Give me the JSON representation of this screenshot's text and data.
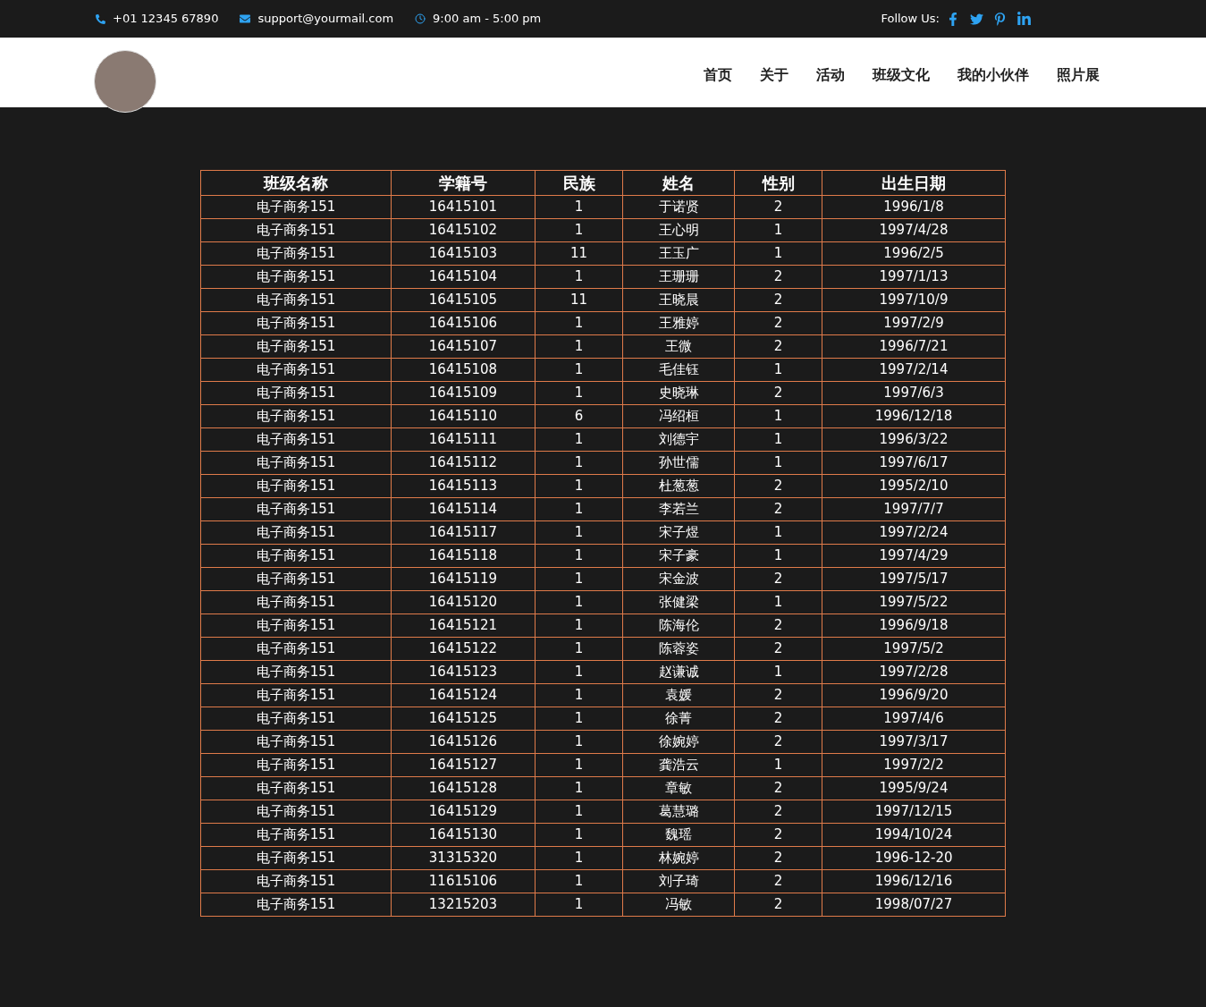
{
  "topbar": {
    "phone": "+01 12345 67890",
    "email": "support@yourmail.com",
    "hours": "9:00 am - 5:00 pm",
    "follow_label": "Follow Us:"
  },
  "nav": {
    "items": [
      {
        "label": "首页"
      },
      {
        "label": "关于"
      },
      {
        "label": "活动"
      },
      {
        "label": "班级文化"
      },
      {
        "label": "我的小伙伴"
      },
      {
        "label": "照片展"
      }
    ]
  },
  "table": {
    "columns": [
      "班级名称",
      "学籍号",
      "民族",
      "姓名",
      "性别",
      "出生日期"
    ],
    "rows": [
      [
        "电子商务151",
        "16415101",
        "1",
        "于诺贤",
        "2",
        "1996/1/8"
      ],
      [
        "电子商务151",
        "16415102",
        "1",
        "王心明",
        "1",
        "1997/4/28"
      ],
      [
        "电子商务151",
        "16415103",
        "11",
        "王玉广",
        "1",
        "1996/2/5"
      ],
      [
        "电子商务151",
        "16415104",
        "1",
        "王珊珊",
        "2",
        "1997/1/13"
      ],
      [
        "电子商务151",
        "16415105",
        "11",
        "王晓晨",
        "2",
        "1997/10/9"
      ],
      [
        "电子商务151",
        "16415106",
        "1",
        "王雅婷",
        "2",
        "1997/2/9"
      ],
      [
        "电子商务151",
        "16415107",
        "1",
        "王微",
        "2",
        "1996/7/21"
      ],
      [
        "电子商务151",
        "16415108",
        "1",
        "毛佳钰",
        "1",
        "1997/2/14"
      ],
      [
        "电子商务151",
        "16415109",
        "1",
        "史晓琳",
        "2",
        "1997/6/3"
      ],
      [
        "电子商务151",
        "16415110",
        "6",
        "冯绍桓",
        "1",
        "1996/12/18"
      ],
      [
        "电子商务151",
        "16415111",
        "1",
        "刘德宇",
        "1",
        "1996/3/22"
      ],
      [
        "电子商务151",
        "16415112",
        "1",
        "孙世儒",
        "1",
        "1997/6/17"
      ],
      [
        "电子商务151",
        "16415113",
        "1",
        "杜葱葱",
        "2",
        "1995/2/10"
      ],
      [
        "电子商务151",
        "16415114",
        "1",
        "李若兰",
        "2",
        "1997/7/7"
      ],
      [
        "电子商务151",
        "16415117",
        "1",
        "宋子煜",
        "1",
        "1997/2/24"
      ],
      [
        "电子商务151",
        "16415118",
        "1",
        "宋子豪",
        "1",
        "1997/4/29"
      ],
      [
        "电子商务151",
        "16415119",
        "1",
        "宋金波",
        "2",
        "1997/5/17"
      ],
      [
        "电子商务151",
        "16415120",
        "1",
        "张健梁",
        "1",
        "1997/5/22"
      ],
      [
        "电子商务151",
        "16415121",
        "1",
        "陈海伦",
        "2",
        "1996/9/18"
      ],
      [
        "电子商务151",
        "16415122",
        "1",
        "陈蓉姿",
        "2",
        "1997/5/2"
      ],
      [
        "电子商务151",
        "16415123",
        "1",
        "赵谦诚",
        "1",
        "1997/2/28"
      ],
      [
        "电子商务151",
        "16415124",
        "1",
        "袁媛",
        "2",
        "1996/9/20"
      ],
      [
        "电子商务151",
        "16415125",
        "1",
        "徐菁",
        "2",
        "1997/4/6"
      ],
      [
        "电子商务151",
        "16415126",
        "1",
        "徐婉婷",
        "2",
        "1997/3/17"
      ],
      [
        "电子商务151",
        "16415127",
        "1",
        "龚浩云",
        "1",
        "1997/2/2"
      ],
      [
        "电子商务151",
        "16415128",
        "1",
        "章敏",
        "2",
        "1995/9/24"
      ],
      [
        "电子商务151",
        "16415129",
        "1",
        "葛慧璐",
        "2",
        "1997/12/15"
      ],
      [
        "电子商务151",
        "16415130",
        "1",
        "魏瑶",
        "2",
        "1994/10/24"
      ],
      [
        "电子商务151",
        "31315320",
        "1",
        "林婉婷",
        "2",
        "1996-12-20"
      ],
      [
        "电子商务151",
        "11615106",
        "1",
        "刘子琦",
        "2",
        "1996/12/16"
      ],
      [
        "电子商务151",
        "13215203",
        "1",
        "冯敏",
        "2",
        "1998/07/27"
      ]
    ]
  }
}
